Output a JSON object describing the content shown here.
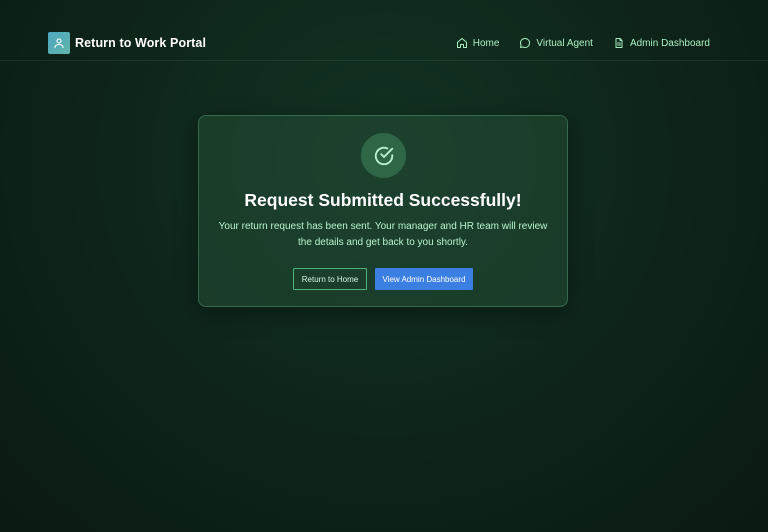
{
  "header": {
    "title": "Return to Work Portal",
    "logo_icon": "user-icon",
    "nav": [
      {
        "label": "Home",
        "icon": "home-icon"
      },
      {
        "label": "Virtual Agent",
        "icon": "chat-bubble-icon"
      },
      {
        "label": "Admin Dashboard",
        "icon": "document-icon"
      }
    ]
  },
  "confirmation": {
    "icon": "check-circle-icon",
    "title": "Request Submitted Successfully!",
    "message": "Your return request has been sent. Your manager and HR team will review the details and get back to you shortly.",
    "secondary_button": "Return to Home",
    "primary_button": "View Admin Dashboard"
  },
  "colors": {
    "background": "#0e2419",
    "accent_text": "#a9f0c3",
    "primary_button": "#3b7fe3",
    "card_border": "#4fb07a",
    "check_circle": "#2f6746"
  }
}
